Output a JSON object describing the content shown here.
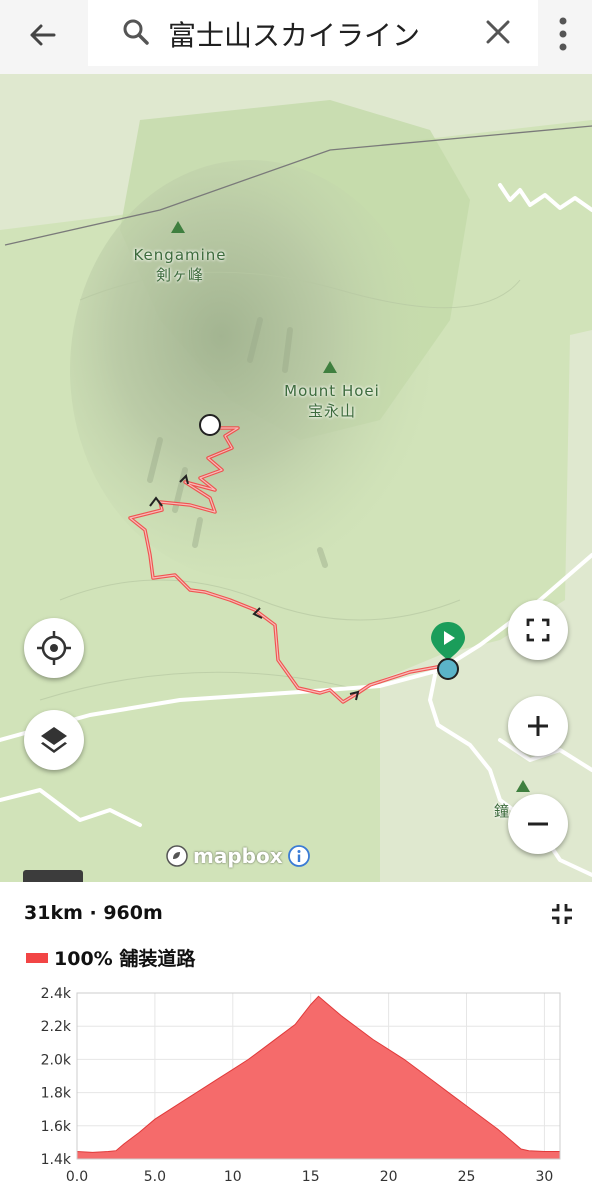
{
  "search": {
    "query": "富士山スカイライン"
  },
  "map": {
    "labels": [
      {
        "name": "Kengamine",
        "jp": "剣ヶ峰"
      },
      {
        "name": "Mount Hoei",
        "jp": "宝永山"
      },
      {
        "name": "",
        "jp": "鐘"
      }
    ],
    "attribution": "mapbox"
  },
  "summary": {
    "stats": "31km · 960m",
    "surface": "100% 舗装道路"
  },
  "colors": {
    "route": "#f24545",
    "start": "#1a9d5a",
    "end": "#5bb4c9"
  },
  "chart_data": {
    "type": "area",
    "x_ticks": [
      "0.0",
      "5.0",
      "10",
      "15",
      "20",
      "25",
      "30"
    ],
    "y_ticks": [
      "1.4k",
      "1.6k",
      "1.8k",
      "2.0k",
      "2.2k",
      "2.4k"
    ],
    "xlim": [
      0,
      31
    ],
    "ylim": [
      1400,
      2400
    ],
    "x": [
      0,
      1,
      2,
      2.5,
      3,
      4,
      5,
      6,
      7,
      8,
      9,
      10,
      11,
      12,
      13,
      14,
      15,
      15.5,
      16,
      17,
      18,
      19,
      20,
      21,
      22,
      23,
      24,
      25,
      26,
      27,
      28,
      28.5,
      29,
      30,
      31
    ],
    "y": [
      1445,
      1440,
      1445,
      1450,
      1490,
      1560,
      1640,
      1700,
      1760,
      1820,
      1880,
      1940,
      2000,
      2070,
      2140,
      2210,
      2330,
      2380,
      2340,
      2260,
      2190,
      2120,
      2060,
      2000,
      1930,
      1860,
      1790,
      1720,
      1650,
      1580,
      1500,
      1460,
      1450,
      1445,
      1445
    ]
  }
}
